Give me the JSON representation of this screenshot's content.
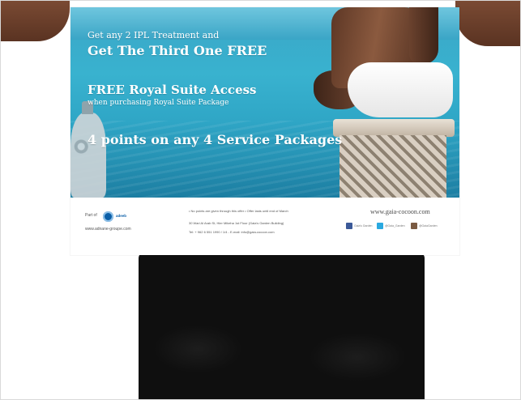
{
  "poster": {
    "offer1_line1": "Get any 2 IPL Treatment and",
    "offer1_line2": "Get The Third One FREE",
    "offer2_line1": "FREE Royal Suite Access",
    "offer2_line2": "when purchasing Royal Suite Package",
    "offer3": "4 points on any 4 Service Packages",
    "footer": {
      "part_of_label": "Part of",
      "part_of_brand": "adeeb",
      "group_url": "www.adnane-groupe.com",
      "notes": "• No points are given through this offer   • Offer lasts until end of March",
      "address": "30 Wari Al Arab St, Hier Mikeha 1st Floor (Gaia's Garden Building)",
      "contact": "Tel: + 962 6 551 1990 / 1/4  -  E-mail: info@gaia-cocoon.com",
      "website": "www.gaia-cocoon.com",
      "social": [
        {
          "icon": "facebook-icon",
          "handle": "Gaia's Garden",
          "color": "#3b5998"
        },
        {
          "icon": "twitter-icon",
          "handle": "@Gaia_Garden",
          "color": "#2aa9e0"
        },
        {
          "icon": "instagram-icon",
          "handle": "@GaiaGarden",
          "color": "#7a5a42"
        }
      ]
    }
  },
  "colors": {
    "sea": "#3aa5c6",
    "text_on_photo": "#ffffff",
    "holder_clothing": "#0f0f0f"
  }
}
